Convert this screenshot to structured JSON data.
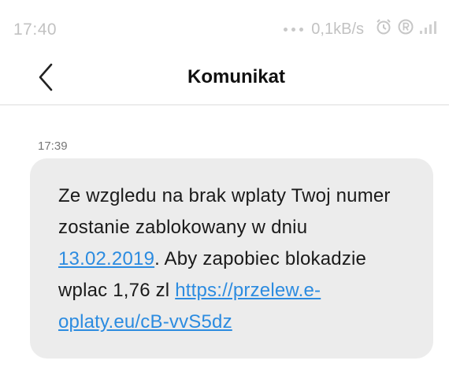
{
  "status_bar": {
    "time": "17:40",
    "network_speed": "0,1kB/s",
    "icons": [
      "more-dots-icon",
      "alarm-icon",
      "r-badge-icon",
      "signal-icon"
    ]
  },
  "header": {
    "title": "Komunikat",
    "back_icon": "chevron-left-icon"
  },
  "message": {
    "time": "17:39",
    "text_part1": "Ze wzgledu na brak wplaty Twoj numer zostanie zablokowany w dniu ",
    "date_link": "13.02.2019",
    "text_part2": ". Aby zapobiec blokadzie wplac 1,76 zl ",
    "url_link": "https://​przelew.e-oplaty.eu/cB-vvS5dz",
    "link_color": "#2b8be0",
    "bubble_color": "#ececec"
  }
}
